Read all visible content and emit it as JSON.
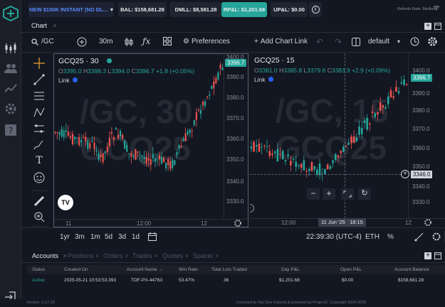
{
  "topbar": {
    "account_select": "NEW $150K INSTANT (NO DL...",
    "bal": "BAL: $158,681.28",
    "dmll": "DMLL: $8,581.28",
    "rpl": "RP&L: $1,201.68",
    "upl": "UP&L: $0.00",
    "refresh_rate": "Refresh Rate: Medium"
  },
  "chart_tab": {
    "label": "Chart"
  },
  "toolbar": {
    "symbol": "/GC",
    "interval": "30m",
    "preferences": "Preferences",
    "add_chart_link": "Add Chart Link",
    "layout": "default"
  },
  "pane_left": {
    "title": "GCQ25 · 30",
    "ohlc_o": "3395.0",
    "ohlc_h": "3398.3",
    "ohlc_l": "3394.0",
    "ohlc_c": "3396.7",
    "change": "+1.8 (+0.05%)",
    "link": "Link",
    "watermark_1": "/GC, 30",
    "watermark_2": "GCQ25",
    "yaxis": [
      "3400.0",
      "3390.0",
      "3380.0",
      "3370.0",
      "3360.0",
      "3350.0",
      "3340.0",
      "3330.0"
    ],
    "price_label": "3396.7",
    "xaxis": [
      "11",
      "12:00",
      "12"
    ]
  },
  "pane_right": {
    "title": "GCQ25 · 15",
    "ohlc_o": "3381.0",
    "ohlc_h": "3385.8",
    "ohlc_l": "3379.6",
    "ohlc_c": "3383.9",
    "change": "+2.9 (+0.09%)",
    "link": "Link",
    "watermark_1": "/GC, 15",
    "watermark_2": "GCQ25",
    "yaxis": [
      "3400.0",
      "3390.0",
      "3380.0",
      "3370.0",
      "3360.0",
      "3350.0",
      "3340.0",
      "3330.0"
    ],
    "price_label": "3396.7",
    "crosshair_label": "3346.0",
    "crosshair_time": "11 Jun '25   18:15",
    "xaxis": [
      "12:00",
      "12"
    ]
  },
  "rangebar": {
    "ranges": [
      "1yr",
      "3m",
      "1m",
      "5d",
      "3d",
      "1d"
    ],
    "clock": "22:39:30 (UTC-4)",
    "symbol": "ETH",
    "percent": "%"
  },
  "accounts": {
    "tabs": [
      "Accounts",
      "Positions",
      "Orders",
      "Trades",
      "Quotes",
      "Spacer"
    ],
    "headers": [
      "Status",
      "Created On",
      "Account Name",
      "Win Rate",
      "Total Lots Traded",
      "Day P&L",
      "Open P&L",
      "Account Balance"
    ],
    "row": [
      "Active",
      "2025-05-21 10:53:53.393",
      "TOF-PX-44763",
      "53.47%",
      "36",
      "$1,201.68",
      "$0.00",
      "$158,681.28"
    ]
  },
  "footer": {
    "version": "Version: 1.17.15",
    "license": "Licensed to Top One Futures & powered by ProjectX. Copyright 2024-2025"
  },
  "colors": {
    "up": "#26a69a",
    "down": "#ef5350",
    "accent": "#2962ff",
    "bg": "#131722"
  }
}
